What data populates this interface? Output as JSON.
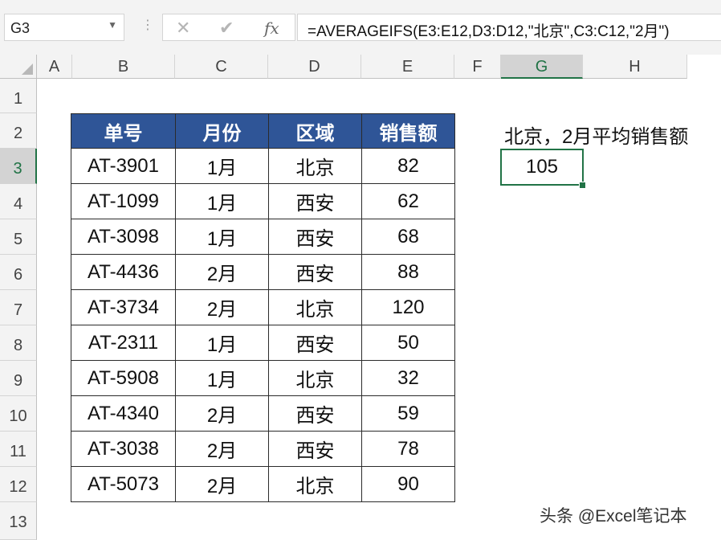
{
  "formula_bar": {
    "name_box": "G3",
    "cancel_icon": "✕",
    "enter_icon": "✔",
    "fx_label": "fx",
    "formula": "=AVERAGEIFS(E3:E12,D3:D12,\"北京\",C3:C12,\"2月\")"
  },
  "columns": [
    "A",
    "B",
    "C",
    "D",
    "E",
    "F",
    "G",
    "H"
  ],
  "selected_column": "G",
  "rows": [
    "1",
    "2",
    "3",
    "4",
    "5",
    "6",
    "7",
    "8",
    "9",
    "10",
    "11",
    "12",
    "13"
  ],
  "selected_row": "3",
  "table": {
    "headers": [
      "单号",
      "月份",
      "区域",
      "销售额"
    ],
    "header_color": "#2f5597",
    "rows": [
      [
        "AT-3901",
        "1月",
        "北京",
        "82"
      ],
      [
        "AT-1099",
        "1月",
        "西安",
        "62"
      ],
      [
        "AT-3098",
        "1月",
        "西安",
        "68"
      ],
      [
        "AT-4436",
        "2月",
        "西安",
        "88"
      ],
      [
        "AT-3734",
        "2月",
        "北京",
        "120"
      ],
      [
        "AT-2311",
        "1月",
        "西安",
        "50"
      ],
      [
        "AT-5908",
        "1月",
        "北京",
        "32"
      ],
      [
        "AT-4340",
        "2月",
        "西安",
        "59"
      ],
      [
        "AT-3038",
        "2月",
        "西安",
        "78"
      ],
      [
        "AT-5073",
        "2月",
        "北京",
        "90"
      ]
    ]
  },
  "result": {
    "label": "北京，2月平均销售额",
    "value": "105"
  },
  "selection_color": "#217346",
  "watermark": "头条 @Excel笔记本"
}
